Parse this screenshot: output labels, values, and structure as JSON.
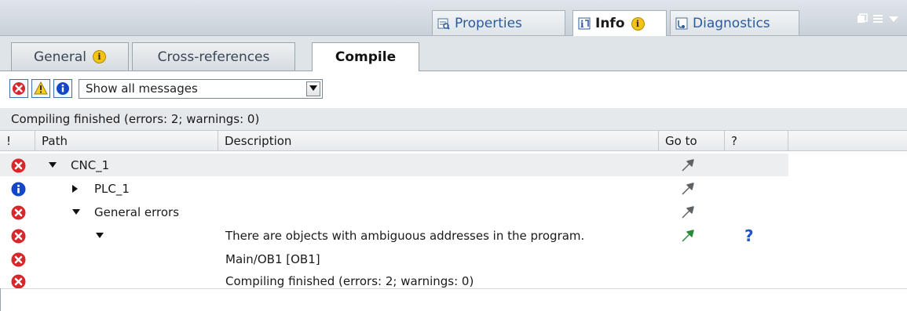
{
  "top_tabs": {
    "properties": "Properties",
    "info": "Info",
    "info_badge": "i",
    "diagnostics": "Diagnostics"
  },
  "sub_tabs": {
    "general": "General",
    "general_badge": "i",
    "cross_references": "Cross-references",
    "compile": "Compile"
  },
  "filter": {
    "selected": "Show all messages"
  },
  "status_text": "Compiling finished (errors: 2; warnings: 0)",
  "columns": {
    "severity": "!",
    "path": "Path",
    "description": "Description",
    "goto": "Go to",
    "help": "?"
  },
  "rows": [
    {
      "status": "error",
      "path": "CNC_1",
      "description": "",
      "goto": "gray-arrow",
      "help": ""
    },
    {
      "status": "info",
      "path": "PLC_1",
      "description": "",
      "goto": "gray-arrow",
      "help": ""
    },
    {
      "status": "error",
      "path": "General errors",
      "description": "",
      "goto": "gray-arrow",
      "help": ""
    },
    {
      "status": "error",
      "path": "",
      "description": "There are objects with ambiguous addresses in the program.",
      "goto": "green-arrow",
      "help": "?"
    },
    {
      "status": "error",
      "path": "",
      "description": "Main/OB1 [OB1]",
      "goto": "",
      "help": ""
    },
    {
      "status": "error",
      "path": "",
      "description": "Compiling finished (errors: 2; warnings: 0)",
      "goto": "",
      "help": ""
    }
  ],
  "colors": {
    "error": "#d9262b",
    "info": "#1646c8",
    "goto_active": "#2a8a3a",
    "goto_inactive": "#5e6266",
    "help": "#2255cc"
  }
}
